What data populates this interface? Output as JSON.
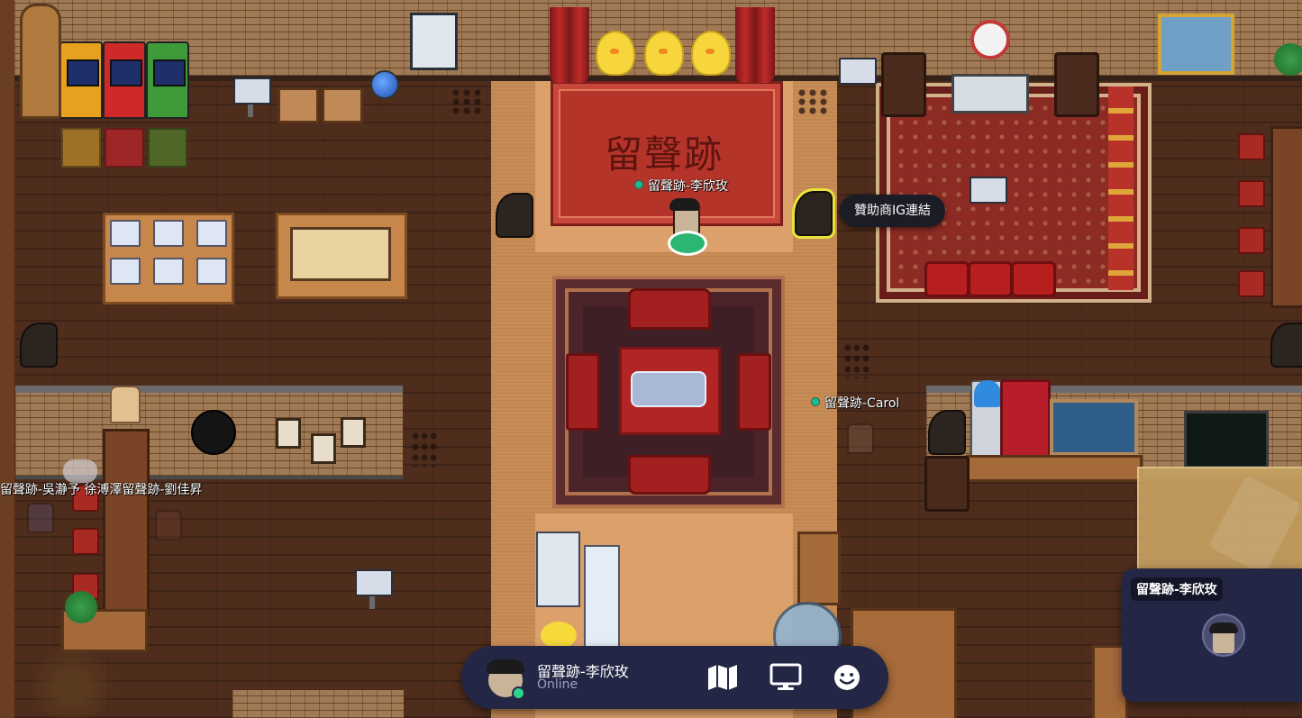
{
  "room": {
    "rug_title": "留聲跡",
    "tooltip": "贊助商IG連結"
  },
  "players": {
    "self_tag": "留聲跡-李欣玫",
    "carol_tag": "留聲跡-Carol",
    "group_tag": "留聲跡-吳瀞予 徐溥澤留聲跡-劉佳昇"
  },
  "bottom_bar": {
    "name": "留聲跡-李欣玫",
    "status": "Online",
    "status_color": "#2bd48a",
    "map_icon": "map-icon",
    "screen_icon": "monitor-icon",
    "emoji_icon": "smiley-icon"
  },
  "video_panel": {
    "participant_name": "留聲跡-李欣玫"
  },
  "colors": {
    "bar_bg": "#232645",
    "tooltip_bg": "#1b1c25",
    "highlight": "#e9e23a"
  }
}
